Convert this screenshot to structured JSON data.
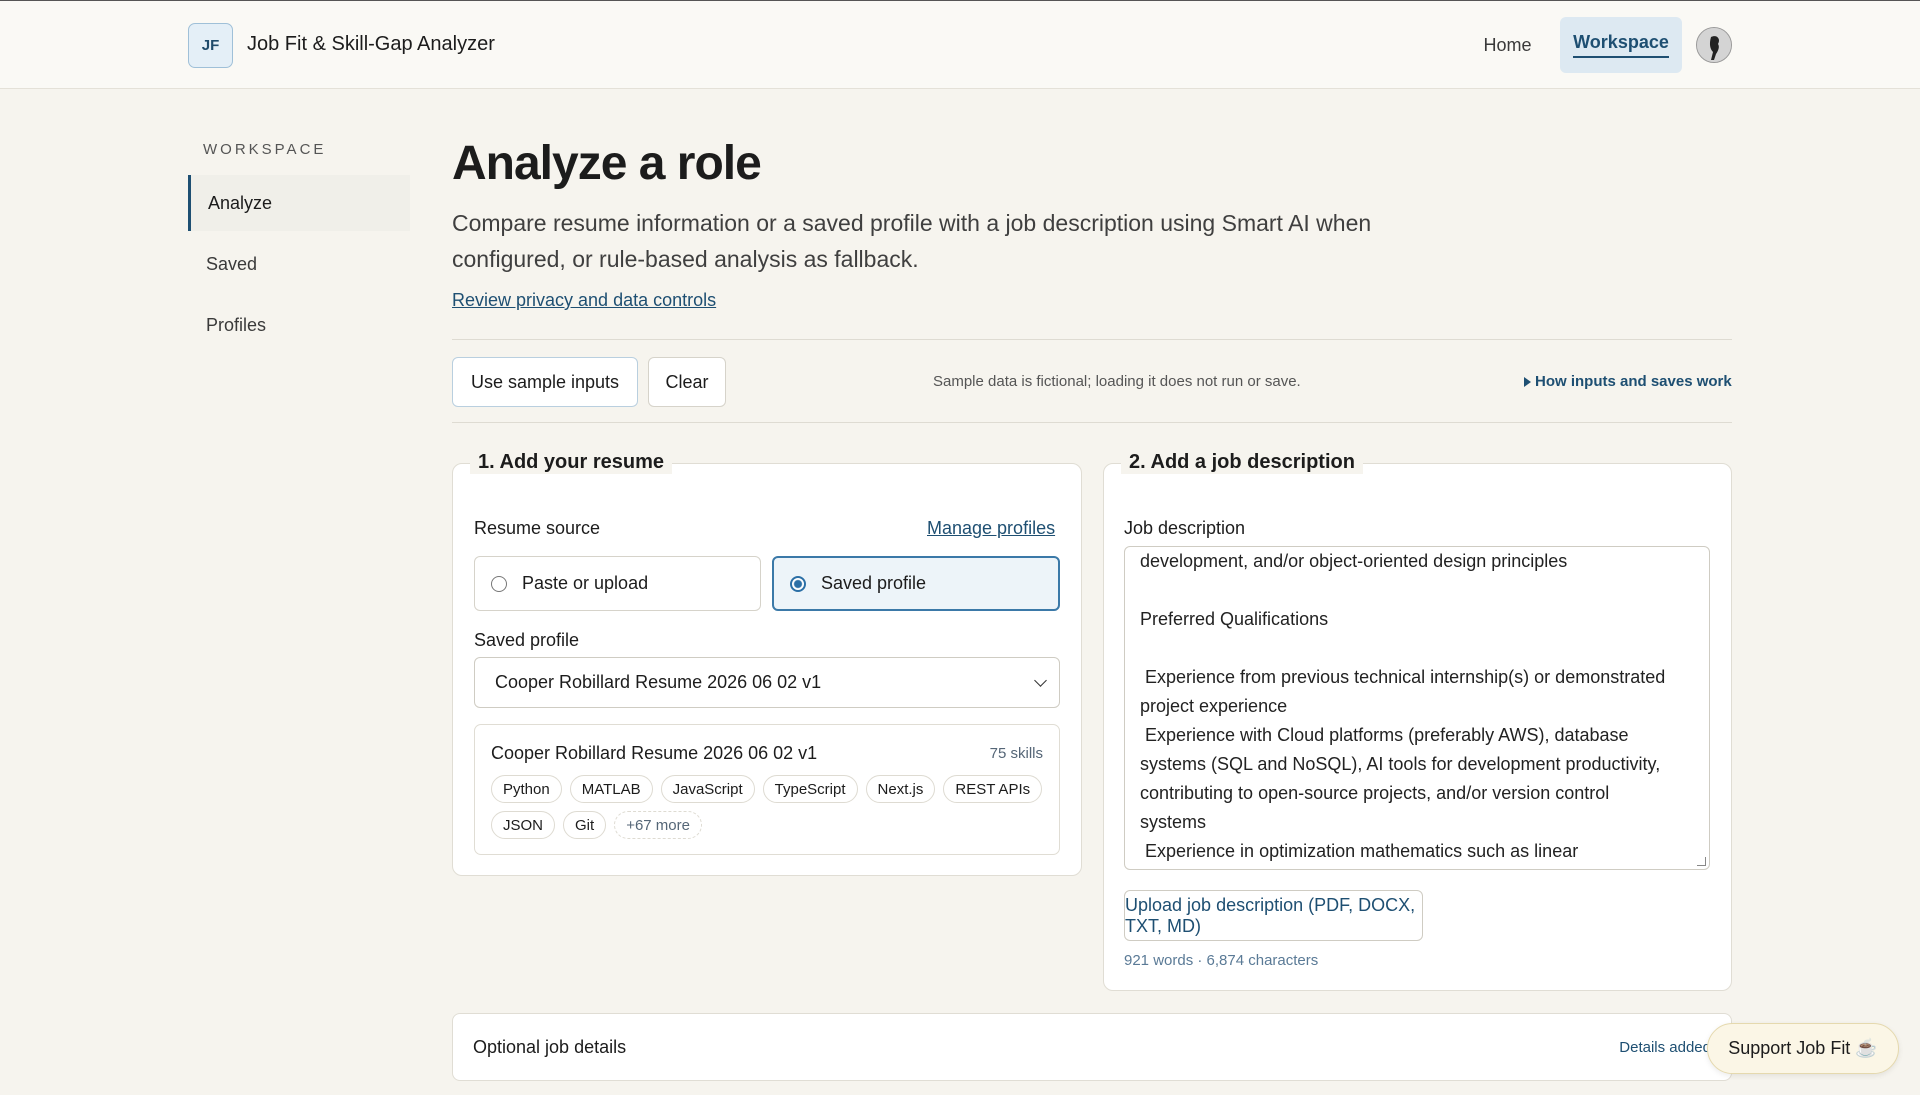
{
  "header": {
    "logo_text": "JF",
    "title": "Job Fit & Skill-Gap Analyzer",
    "nav": {
      "home": "Home",
      "workspace": "Workspace"
    }
  },
  "sidebar": {
    "heading": "WORKSPACE",
    "items": [
      {
        "label": "Analyze"
      },
      {
        "label": "Saved"
      },
      {
        "label": "Profiles"
      }
    ]
  },
  "main": {
    "title": "Analyze a role",
    "subtitle": "Compare resume information or a saved profile with a job description using Smart AI when configured, or rule-based analysis as fallback.",
    "privacy_link": "Review privacy and data controls",
    "toolbar": {
      "sample_button": "Use sample inputs",
      "clear_button": "Clear",
      "sample_note": "Sample data is fictional; loading it does not run or save.",
      "how_link": "How inputs and saves work"
    },
    "resume": {
      "legend": "1. Add your resume",
      "source_label": "Resume source",
      "manage_link": "Manage profiles",
      "options": [
        "Paste or upload",
        "Saved profile"
      ],
      "selected_option": "Saved profile",
      "saved_profile_label": "Saved profile",
      "saved_profile_value": "Cooper Robillard Resume 2026 06 02 v1",
      "card": {
        "name": "Cooper Robillard Resume 2026 06 02 v1",
        "skill_count": "75 skills",
        "skills": [
          "Python",
          "MATLAB",
          "JavaScript",
          "TypeScript",
          "Next.js",
          "REST APIs",
          "JSON",
          "Git"
        ],
        "more": "+67 more"
      }
    },
    "job": {
      "legend": "2. Add a job description",
      "label": "Job description",
      "text_lines": [
        "development, and/or object-oriented design principles",
        "",
        "Preferred Qualifications",
        "",
        " Experience from previous technical internship(s) or demonstrated",
        "project experience",
        " Experience with Cloud platforms (preferably AWS), database",
        "systems (SQL and NoSQL), AI tools for development productivity,",
        "contributing to open-source projects, and/or version control",
        "systems",
        " Experience in optimization mathematics such as linear"
      ],
      "upload_button": "Upload job description (PDF, DOCX, TXT, MD)",
      "word_count": "921 words · 6,874 characters"
    },
    "optional": {
      "title": "Optional job details",
      "status": "Details added"
    }
  },
  "support_button": "Support Job Fit ☕",
  "colors": {
    "accent": "#1e4f72",
    "background": "#f6f4ee",
    "nav_active_bg": "#dde9f2"
  }
}
